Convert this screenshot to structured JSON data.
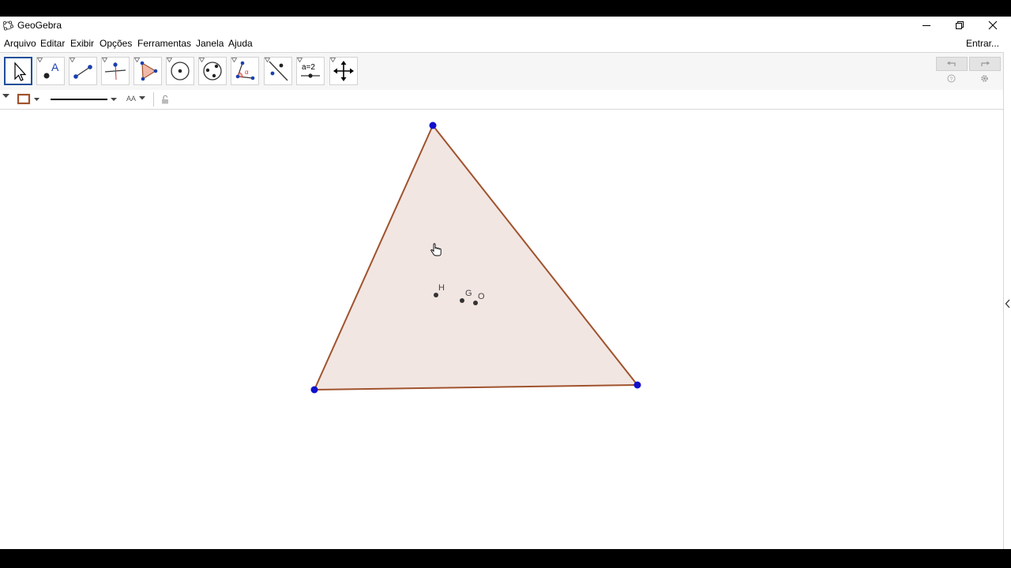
{
  "window": {
    "title": "GeoGebra",
    "controls": {
      "minimize": "minimize",
      "maximize": "restore",
      "close": "close"
    }
  },
  "menu": {
    "items": [
      "Arquivo",
      "Editar",
      "Exibir",
      "Opções",
      "Ferramentas",
      "Janela",
      "Ajuda"
    ],
    "login": "Entrar..."
  },
  "toolbar": {
    "tools": [
      {
        "name": "move-tool",
        "icon": "arrow-cursor-icon",
        "active": true
      },
      {
        "name": "point-tool",
        "icon": "point-icon",
        "label": "A"
      },
      {
        "name": "line-tool",
        "icon": "line-icon"
      },
      {
        "name": "perpendicular-tool",
        "icon": "perpendicular-icon"
      },
      {
        "name": "polygon-tool",
        "icon": "polygon-icon"
      },
      {
        "name": "circle-tool",
        "icon": "circle-icon"
      },
      {
        "name": "conic-tool",
        "icon": "ellipse-icon"
      },
      {
        "name": "angle-tool",
        "icon": "angle-icon",
        "label": "α"
      },
      {
        "name": "reflect-tool",
        "icon": "reflect-icon"
      },
      {
        "name": "slider-tool",
        "icon": "slider-icon",
        "label": "a=2"
      },
      {
        "name": "move-graphics-tool",
        "icon": "move-view-icon"
      }
    ]
  },
  "stylebar": {
    "font_size_label": "AA"
  },
  "figure": {
    "point_labels": [
      "H",
      "G",
      "O"
    ],
    "colors": {
      "vertex": "#1010cc",
      "edge": "#a0522d",
      "fill": "#f2e6e2",
      "center_point": "#333333"
    }
  }
}
